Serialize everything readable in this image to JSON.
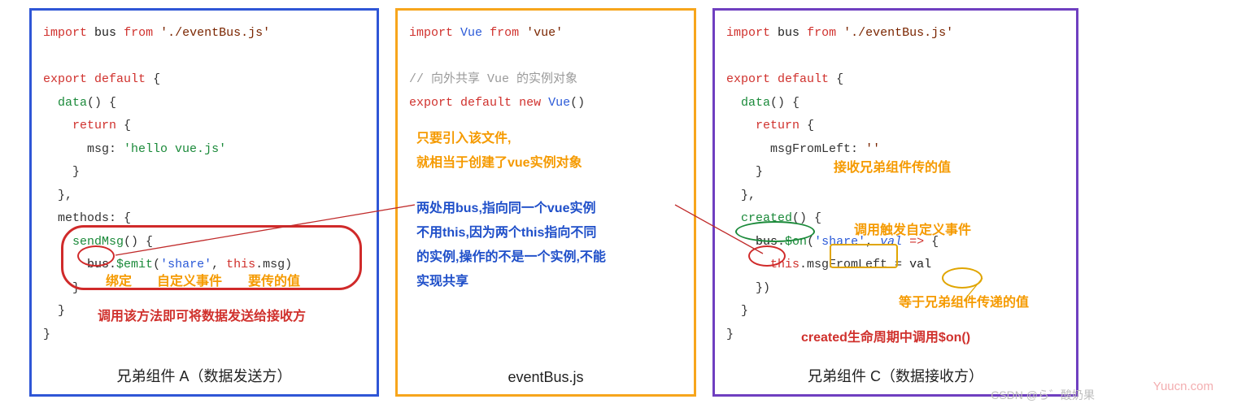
{
  "panelA": {
    "caption": "兄弟组件 A（数据发送方）",
    "line1": {
      "import": "import",
      "bus": "bus",
      "from": "from",
      "path": "'./eventBus.js'"
    },
    "line3": {
      "export_": "export",
      "default_": "default",
      "brace": "{"
    },
    "line4": {
      "data": "data",
      "paren": "() {"
    },
    "line5": {
      "return_": "return",
      "brace": "{"
    },
    "line6": {
      "msg": "msg:",
      "val": "'hello vue.js'"
    },
    "line7": "    }",
    "line8": "  },",
    "line9": {
      "methods": "methods",
      "tail": ": {"
    },
    "line10": {
      "sendMsg": "sendMsg",
      "tail": "() {"
    },
    "line11": {
      "bus": "bus",
      "dot": ".",
      "emit": "$emit",
      "open": "(",
      "share": "'share'",
      "comma": ",",
      "this_": "this",
      "dotmsg": ".msg)"
    },
    "line12": "    }",
    "line13": "  }",
    "line14": "}",
    "anno_row": {
      "bind": "绑定",
      "custom_evt": "自定义事件",
      "value": "要传的值"
    },
    "anno_call": "调用该方法即可将数据发送给接收方"
  },
  "panelB": {
    "caption": "eventBus.js",
    "line1": {
      "import": "import",
      "vue": "Vue",
      "from": "from",
      "pkg": "'vue'"
    },
    "comment": "// 向外共享 Vue 的实例对象",
    "line3": {
      "export_": "export",
      "default_": "default",
      "new_": "new",
      "vue": "Vue",
      "call": "()"
    },
    "note1a": "只要引入该文件,",
    "note1b": "就相当于创建了vue实例对象",
    "note2a": "两处用bus,指向同一个vue实例",
    "note2b": "不用this,因为两个this指向不同",
    "note2c": "的实例,操作的不是一个实例,不能",
    "note2d": "实现共享"
  },
  "panelC": {
    "caption": "兄弟组件 C（数据接收方）",
    "line1": {
      "import": "import",
      "bus": "bus",
      "from": "from",
      "path": "'./eventBus.js'"
    },
    "line3": {
      "export_": "export",
      "default_": "default",
      "brace": "{"
    },
    "line4": {
      "data": "data",
      "paren": "() {"
    },
    "line5": {
      "return_": "return",
      "brace": "{"
    },
    "line6": {
      "key": "msgFromLeft:",
      "val": "''"
    },
    "line7": "    }",
    "line8": "  },",
    "line9": {
      "created": "created",
      "tail": "() {"
    },
    "line10": {
      "bus": "bus",
      "dot": ".",
      "on": "$on",
      "open": "(",
      "share": "'share'",
      "comma": ",",
      "val": "val",
      "arrow": " => ",
      "brace": "{"
    },
    "line11": {
      "this_": "this",
      "assign": ".msgFromLeft = ",
      "val": "val"
    },
    "line12": "    })",
    "line13": "  }",
    "line14": "}",
    "anno_recv": "接收兄弟组件传的值",
    "anno_trigger": "调用触发自定义事件",
    "anno_equal": "等于兄弟组件传递的值",
    "anno_created": "created生命周期中调用$on()"
  },
  "watermark1": "CSDN @ら゛酸奶果",
  "watermark2": "Yuucn.com"
}
